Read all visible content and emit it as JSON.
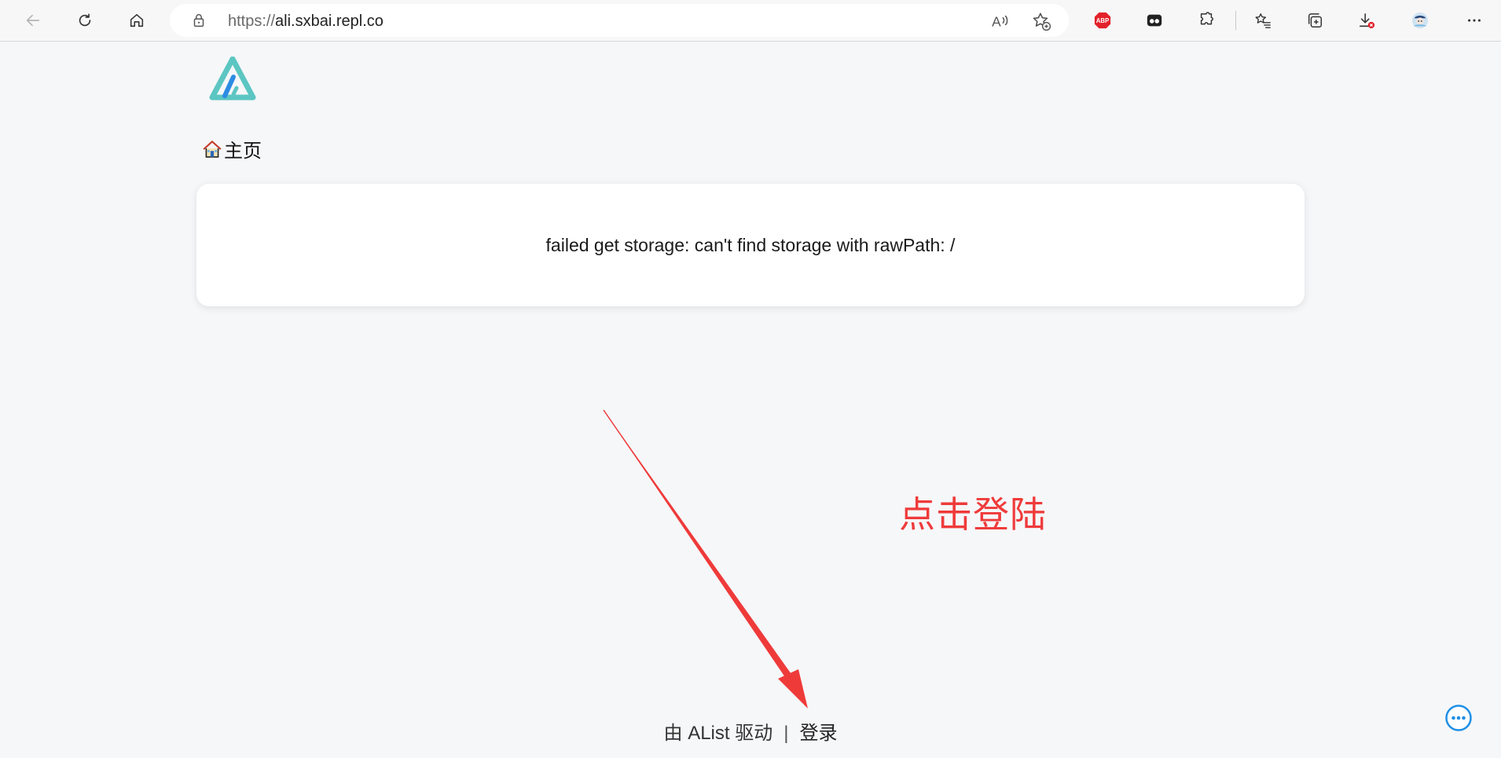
{
  "browser": {
    "url_scheme": "https://",
    "url_host": "ali.sxbai.repl.co",
    "icons": [
      "back-icon",
      "refresh-icon",
      "home-icon",
      "lock-icon",
      "read-aloud-icon",
      "add-favorite-icon",
      "adblock-plus-icon",
      "extension-icon",
      "puzzle-extensions-icon",
      "favorites-icon",
      "collections-icon",
      "downloads-icon",
      "profile-avatar",
      "more-menu-icon"
    ],
    "abp_label": "ABP"
  },
  "page": {
    "breadcrumb": {
      "label": "主页"
    },
    "error_message": "failed get storage: can't find storage with rawPath: /",
    "annotation": "点击登陆",
    "footer": {
      "powered_by": "由 AList 驱动",
      "separator": "|",
      "login": "登录"
    }
  },
  "colors": {
    "accent_teal": "#5cc6c2",
    "accent_blue": "#2c8be3",
    "annotation_red": "#ef3a3a",
    "fab_blue": "#1e90e6"
  }
}
